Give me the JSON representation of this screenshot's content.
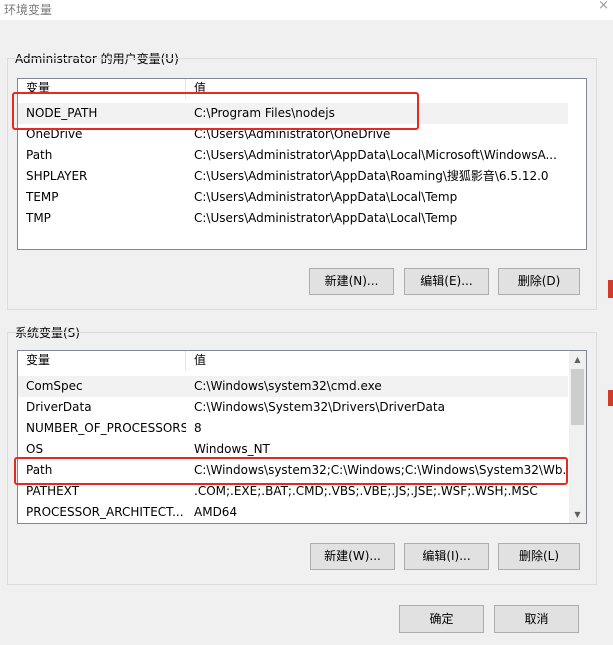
{
  "window": {
    "title": "环境变量",
    "close_glyph": "×"
  },
  "user_vars": {
    "group_label": "Administrator 的用户变量(U)",
    "columns": [
      "变量",
      "值"
    ],
    "rows": [
      {
        "name": "NODE_PATH",
        "value": "C:\\Program Files\\nodejs"
      },
      {
        "name": "OneDrive",
        "value": "C:\\Users\\Administrator\\OneDrive"
      },
      {
        "name": "Path",
        "value": "C:\\Users\\Administrator\\AppData\\Local\\Microsoft\\WindowsA..."
      },
      {
        "name": "SHPLAYER",
        "value": "C:\\Users\\Administrator\\AppData\\Roaming\\搜狐影音\\6.5.12.0"
      },
      {
        "name": "TEMP",
        "value": "C:\\Users\\Administrator\\AppData\\Local\\Temp"
      },
      {
        "name": "TMP",
        "value": "C:\\Users\\Administrator\\AppData\\Local\\Temp"
      }
    ],
    "buttons": {
      "new": "新建(N)...",
      "edit": "编辑(E)...",
      "delete": "删除(D)"
    }
  },
  "system_vars": {
    "group_label": "系统变量(S)",
    "columns": [
      "变量",
      "值"
    ],
    "rows": [
      {
        "name": "ComSpec",
        "value": "C:\\Windows\\system32\\cmd.exe"
      },
      {
        "name": "DriverData",
        "value": "C:\\Windows\\System32\\Drivers\\DriverData"
      },
      {
        "name": "NUMBER_OF_PROCESSORS",
        "value": "8"
      },
      {
        "name": "OS",
        "value": "Windows_NT"
      },
      {
        "name": "Path",
        "value": "C:\\Windows\\system32;C:\\Windows;C:\\Windows\\System32\\Wb..."
      },
      {
        "name": "PATHEXT",
        "value": ".COM;.EXE;.BAT;.CMD;.VBS;.VBE;.JS;.JSE;.WSF;.WSH;.MSC"
      },
      {
        "name": "PROCESSOR_ARCHITECT...",
        "value": "AMD64"
      }
    ],
    "buttons": {
      "new": "新建(W)...",
      "edit": "编辑(I)...",
      "delete": "删除(L)"
    },
    "scroll_up_glyph": "▲",
    "scroll_down_glyph": "▼"
  },
  "footer": {
    "ok": "确定",
    "cancel": "取消"
  },
  "colors": {
    "highlight": "#e52a1f",
    "selected_row": "#f2f2f2"
  }
}
